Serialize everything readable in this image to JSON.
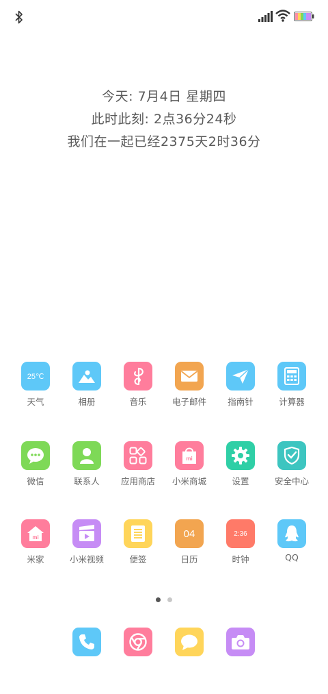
{
  "status_bar": {
    "bluetooth": "bluetooth-icon",
    "signal": "signal-icon",
    "wifi": "wifi-icon",
    "battery": "battery-icon"
  },
  "widget": {
    "line1": "今天: 7月4日 星期四",
    "line2": "此时此刻: 2点36分24秒",
    "line3": "我们在一起已经2375天2时36分"
  },
  "apps": [
    {
      "label": "天气",
      "icon": "weather-icon",
      "color": "#5ec8f8",
      "icon_text": "25℃"
    },
    {
      "label": "相册",
      "icon": "gallery-icon",
      "color": "#5ec8f8"
    },
    {
      "label": "音乐",
      "icon": "music-icon",
      "color": "#ff7d9c"
    },
    {
      "label": "电子邮件",
      "icon": "email-icon",
      "color": "#f2a550"
    },
    {
      "label": "指南针",
      "icon": "compass-icon",
      "color": "#5ec8f8"
    },
    {
      "label": "计算器",
      "icon": "calculator-icon",
      "color": "#5ec8f8"
    },
    {
      "label": "微信",
      "icon": "wechat-icon",
      "color": "#7ed957"
    },
    {
      "label": "联系人",
      "icon": "contacts-icon",
      "color": "#7ed957"
    },
    {
      "label": "应用商店",
      "icon": "app-store-icon",
      "color": "#ff7d9c"
    },
    {
      "label": "小米商城",
      "icon": "mi-store-icon",
      "color": "#ff7d9c",
      "icon_text": "mi"
    },
    {
      "label": "设置",
      "icon": "settings-icon",
      "color": "#2fcfa6"
    },
    {
      "label": "安全中心",
      "icon": "security-icon",
      "color": "#3dc5c0"
    },
    {
      "label": "米家",
      "icon": "mijia-icon",
      "color": "#ff7d9c",
      "icon_text": "mi"
    },
    {
      "label": "小米视频",
      "icon": "video-icon",
      "color": "#c68cf5"
    },
    {
      "label": "便签",
      "icon": "notes-icon",
      "color": "#ffd55a"
    },
    {
      "label": "日历",
      "icon": "calendar-icon",
      "color": "#f2a550",
      "icon_text": "04"
    },
    {
      "label": "时钟",
      "icon": "clock-icon",
      "color": "#ff7a68",
      "icon_text": "2:36"
    },
    {
      "label": "QQ",
      "icon": "qq-icon",
      "color": "#5ec8f8"
    }
  ],
  "page_indicator": {
    "current": 1,
    "total": 2
  },
  "dock": [
    {
      "icon": "phone-icon",
      "color": "#5ec8f8"
    },
    {
      "icon": "browser-icon",
      "color": "#ff7d9c"
    },
    {
      "icon": "messages-icon",
      "color": "#ffd55a"
    },
    {
      "icon": "camera-icon",
      "color": "#c68cf5"
    }
  ]
}
